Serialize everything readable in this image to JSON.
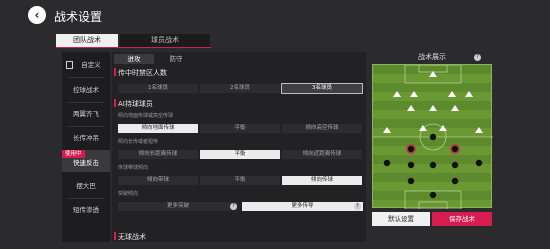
{
  "header": {
    "back_icon": "back-arrow-icon",
    "title": "战术设置"
  },
  "top_tabs": [
    {
      "label": "团队战术",
      "active": true
    },
    {
      "label": "球员战术",
      "active": false
    }
  ],
  "sidebar": {
    "badge": "使用中",
    "items": [
      {
        "label": "自定义"
      },
      {
        "label": "控球战术"
      },
      {
        "label": "两翼齐飞"
      },
      {
        "label": "长传冲吊"
      },
      {
        "label": "快速反击",
        "active": true
      },
      {
        "label": "摆大巴"
      },
      {
        "label": "短传渗透"
      }
    ]
  },
  "center": {
    "sub_tabs": [
      {
        "label": "进攻",
        "active": true
      },
      {
        "label": "防守",
        "active": false
      }
    ],
    "section1": {
      "title": "传中时禁区人数",
      "options": [
        "1名球员",
        "2名球员",
        "3名球员"
      ],
      "selected": 2
    },
    "section2": {
      "title": "AI持球球员",
      "groups": [
        {
          "label": "倾向地面传球或高空传球",
          "options": [
            "倾向地面传球",
            "平衡",
            "倾向高空传球"
          ],
          "selected": 0
        },
        {
          "label": "倾向长传或者短传",
          "options": [
            "倾向长距离传球",
            "平衡",
            "倾向近距离传球"
          ],
          "selected": 1
        },
        {
          "label": "传球带球倾向",
          "options": [
            "倾向带球",
            "平衡",
            "倾向传球"
          ],
          "selected": 2
        },
        {
          "label": "突破倾向",
          "options": [
            "更多突破",
            "更多传导"
          ],
          "selected": 1
        }
      ]
    },
    "section3": {
      "title": "无球战术"
    }
  },
  "right": {
    "title": "战术展示",
    "default_button": "默认设置",
    "save_button": "保存战术",
    "pitch_colors": {
      "light": "#6a9833",
      "dark": "#5d8a2c"
    }
  }
}
